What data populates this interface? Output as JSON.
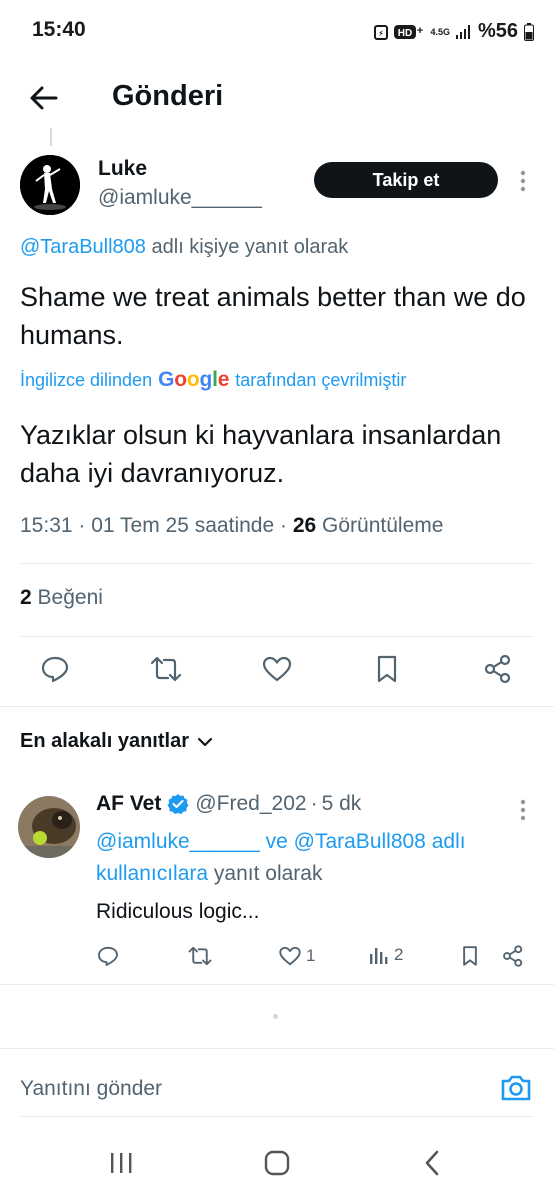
{
  "status_bar": {
    "time": "15:40",
    "network": "4.5G",
    "battery": "%56"
  },
  "header": {
    "title": "Gönderi"
  },
  "tweet": {
    "author_name": "Luke",
    "author_handle": "@iamluke______",
    "follow_label": "Takip et",
    "reply_to_handle": "@TaraBull808",
    "reply_to_suffix": "adlı kişiye yanıt olarak",
    "text": "Shame we treat animals better than we do humans.",
    "translated_from": "İngilizce dilinden",
    "translated_brand": "Google",
    "translated_suffix": "tarafından çevrilmiştir",
    "translated_text": "Yazıklar olsun ki hayvanlara insanlardan daha iyi davranıyoruz.",
    "time": "15:31",
    "date": "01 Tem 25 saatinde",
    "views_count": "26",
    "views_label": "Görüntüleme",
    "likes_count": "2",
    "likes_label": "Beğeni"
  },
  "replies_section": {
    "sort_label": "En alakalı yanıtlar"
  },
  "reply": {
    "name": "AF Vet",
    "handle": "@Fred_202",
    "time": "5 dk",
    "context_handle1": "@iamluke______",
    "context_and": "ve",
    "context_handle2": "@TaraBull808",
    "context_mid": "adlı kullanıcılara",
    "context_suffix": "yanıt olarak",
    "text": "Ridiculous logic...",
    "like_count": "1",
    "views_count": "2"
  },
  "composer": {
    "placeholder": "Yanıtını gönder"
  },
  "colors": {
    "accent": "#1d9bf0",
    "text": "#0f1419",
    "muted": "#536471",
    "border": "#e6ecf0"
  },
  "icons": [
    "back-arrow-icon",
    "more-vertical-icon",
    "reply-icon",
    "retweet-icon",
    "heart-icon",
    "bookmark-icon",
    "share-icon",
    "chevron-down-icon",
    "verified-icon",
    "analytics-icon",
    "camera-icon",
    "recent-apps-icon",
    "home-icon",
    "nav-back-icon"
  ]
}
